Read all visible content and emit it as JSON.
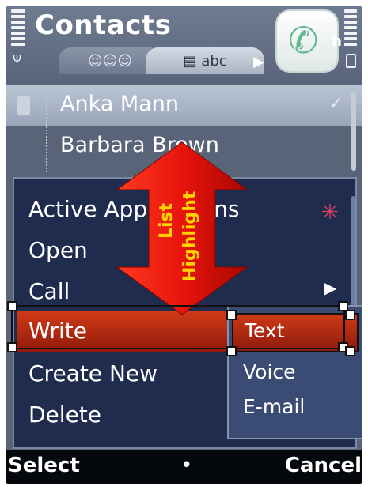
{
  "header": {
    "title": "Contacts",
    "tabs": [
      {
        "label": "",
        "icon": "group-icon",
        "glyph": "☺☺☺"
      },
      {
        "label": "abc",
        "icon": "card-icon",
        "glyph": "▤"
      }
    ],
    "app_icon": "phone-handset-icon",
    "app_icon_fragment": "h"
  },
  "contacts": [
    {
      "name": "Anka Mann",
      "highlighted": true
    },
    {
      "name": "Barbara Brown",
      "highlighted": false
    }
  ],
  "menu": {
    "items": [
      {
        "label": "Active Applications",
        "has_submenu": false
      },
      {
        "label": "Open",
        "has_submenu": false
      },
      {
        "label": "Call",
        "has_submenu": true
      },
      {
        "label": "Write",
        "has_submenu": true,
        "selected": true
      },
      {
        "label": "Create New",
        "has_submenu": false
      },
      {
        "label": "Delete",
        "has_submenu": false
      }
    ],
    "active_apps_icon": "multitask-icon"
  },
  "submenu": {
    "items": [
      {
        "label": "Text",
        "selected": true
      },
      {
        "label": "Voice"
      },
      {
        "label": "E-mail"
      }
    ]
  },
  "annotation": {
    "line1": "List",
    "line2": "Highlight",
    "arrow_color": "#e8140c",
    "text_color": "#ffd200"
  },
  "softkeys": {
    "left": "Select",
    "center": "•",
    "right": "Cancel"
  },
  "colors": {
    "highlight": "#c0341a",
    "menu_bg": "#1f2c4e",
    "submenu_bg": "#3a4b74"
  }
}
